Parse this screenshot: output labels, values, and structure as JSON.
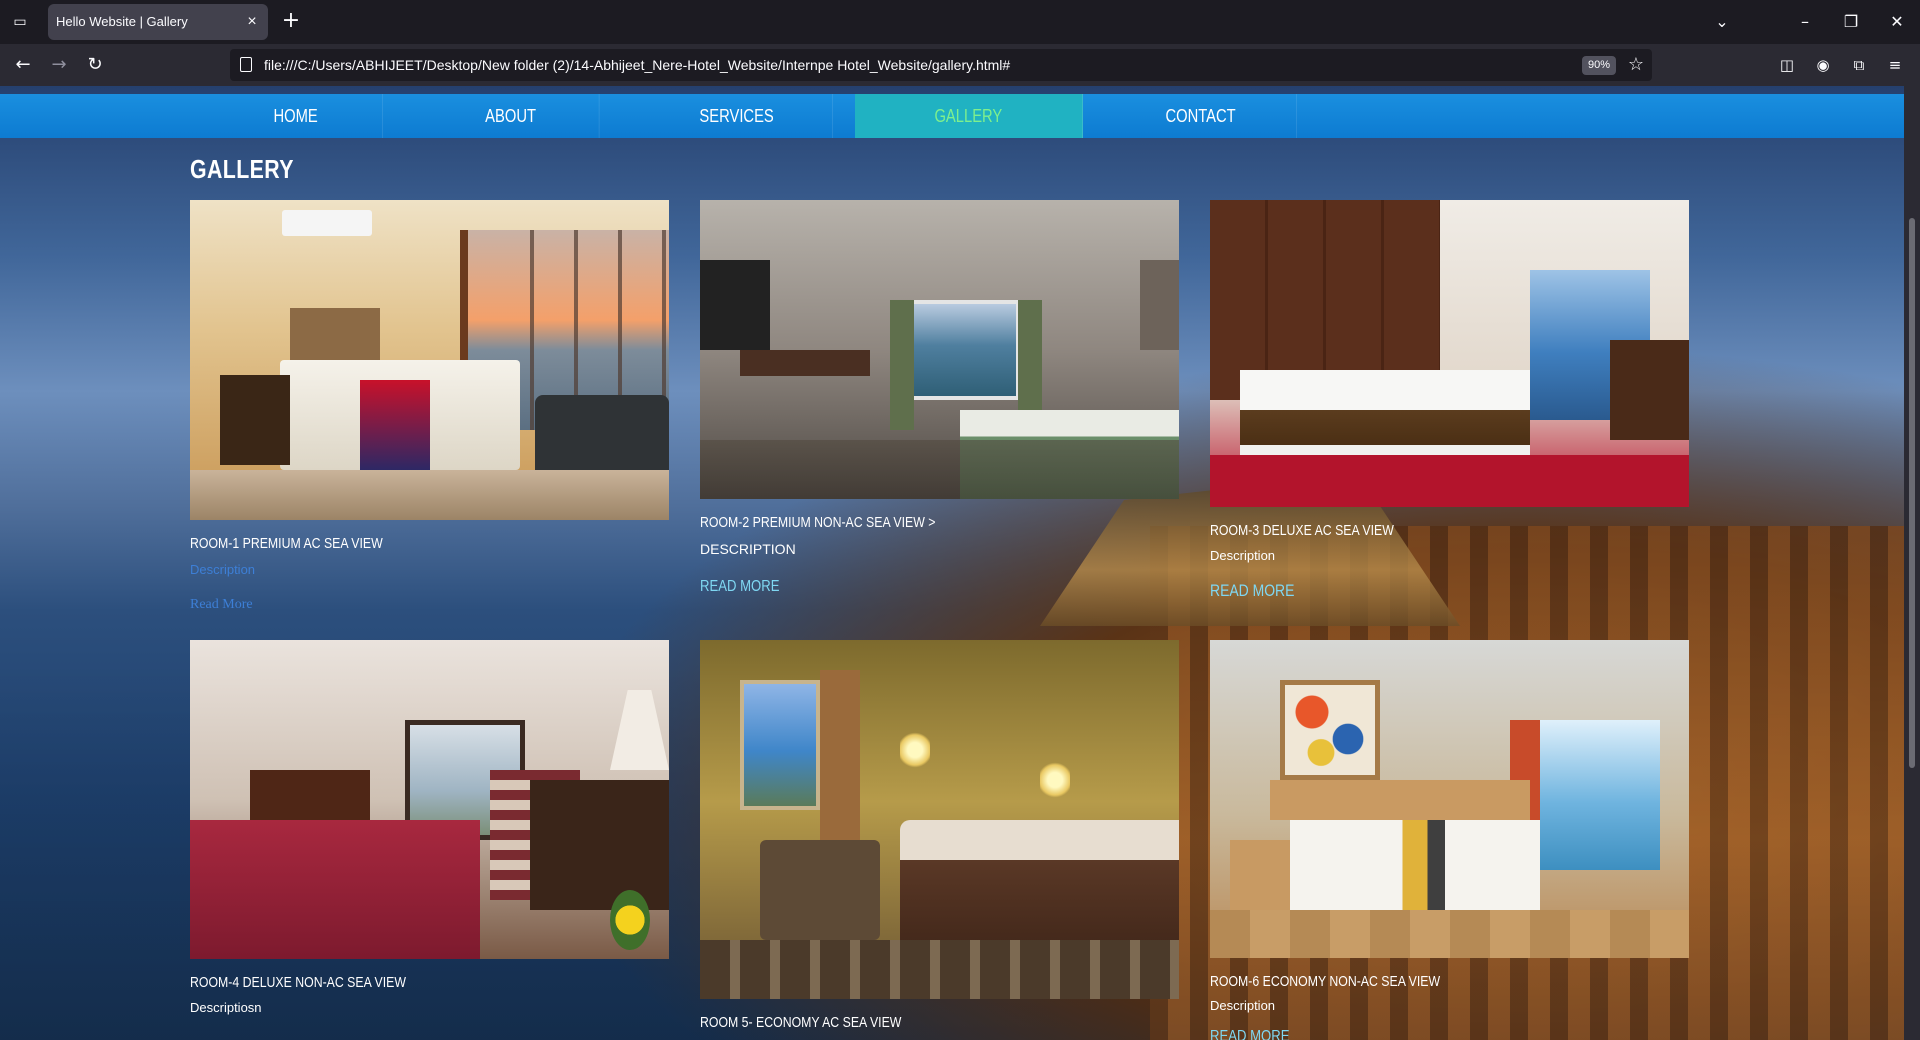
{
  "browser": {
    "tab_title": "Hello Website | Gallery",
    "url": "file:///C:/Users/ABHIJEET/Desktop/New folder (2)/14-Abhijeet_Nere-Hotel_Website/Internpe Hotel_Website/gallery.html#",
    "zoom": "90%"
  },
  "menu": {
    "items": [
      {
        "label": "HOME"
      },
      {
        "label": "ABOUT"
      },
      {
        "label": "SERVICES"
      },
      {
        "label": "GALLERY"
      },
      {
        "label": "CONTACT"
      }
    ],
    "active": "GALLERY"
  },
  "gallery": {
    "title": "GALLERY",
    "rooms": [
      {
        "title": "ROOM-1 PREMIUM AC SEA VIEW",
        "description": "Description",
        "link": "Read More"
      },
      {
        "title": "ROOM-2 PREMIUM NON-AC SEA VIEW >",
        "description": "DESCRIPTION",
        "link": "READ MORE"
      },
      {
        "title": "ROOM-3 DELUXE AC SEA VIEW",
        "description": "Description",
        "link": "READ MORE"
      },
      {
        "title": "ROOM-4 DELUXE NON-AC SEA VIEW",
        "description": "Descriptiosn",
        "link": ""
      },
      {
        "title": "ROOM 5- ECONOMY AC SEA VIEW",
        "description": "",
        "link": ""
      },
      {
        "title": "ROOM-6 ECONOMY NON-AC SEA VIEW",
        "description": "Description",
        "link": "READ MORE"
      }
    ]
  },
  "colors": {
    "menu_bg": "#0d7bd1",
    "menu_active_bg": "#20b2c2",
    "menu_active_text": "#7ef08d",
    "link_blue": "#3d7fd6",
    "link_cyan": "#7fd7f2"
  }
}
